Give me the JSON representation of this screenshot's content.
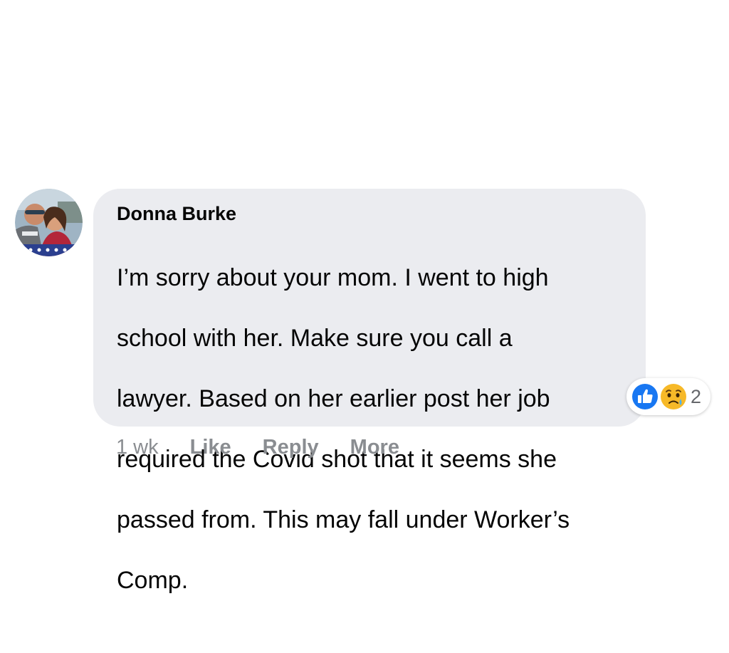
{
  "comment": {
    "author": "Donna Burke",
    "text_lines": [
      "I’m sorry about your mom. I went to high",
      "school with her. Make sure you call a",
      "lawyer. Based on her earlier post her job",
      "required the Covid shot that it seems she",
      "passed from. This may fall under Worker’s",
      "Comp."
    ],
    "avatar_icon": "profile-photo",
    "reactions": {
      "icons": [
        "like-icon",
        "sad-icon"
      ],
      "count": "2"
    },
    "actions": {
      "timestamp": "1 wk",
      "like_label": "Like",
      "reply_label": "Reply",
      "more_label": "More"
    }
  },
  "colors": {
    "bubble_bg": "#ebecf0",
    "text": "#050505",
    "meta_text": "#8a8d91",
    "like_blue": "#1877f2",
    "sad_yellow": "#f7b928"
  }
}
